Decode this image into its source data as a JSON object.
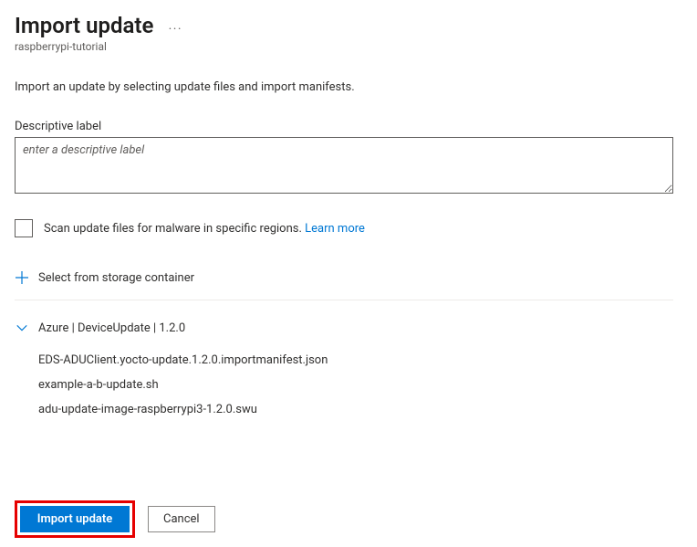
{
  "header": {
    "title": "Import update",
    "subtitle": "raspberrypi-tutorial"
  },
  "instruction": "Import an update by selecting update files and import manifests.",
  "label": {
    "field": "Descriptive label",
    "placeholder": "enter a descriptive label"
  },
  "scan": {
    "text": "Scan update files for malware in specific regions. ",
    "link": "Learn more"
  },
  "storage_action": "Select from storage container",
  "group": {
    "label": "Azure | DeviceUpdate | 1.2.0",
    "files": [
      "EDS-ADUClient.yocto-update.1.2.0.importmanifest.json",
      "example-a-b-update.sh",
      "adu-update-image-raspberrypi3-1.2.0.swu"
    ]
  },
  "footer": {
    "primary": "Import update",
    "secondary": "Cancel"
  },
  "colors": {
    "accent": "#0078d4",
    "highlight": "#e60000"
  }
}
